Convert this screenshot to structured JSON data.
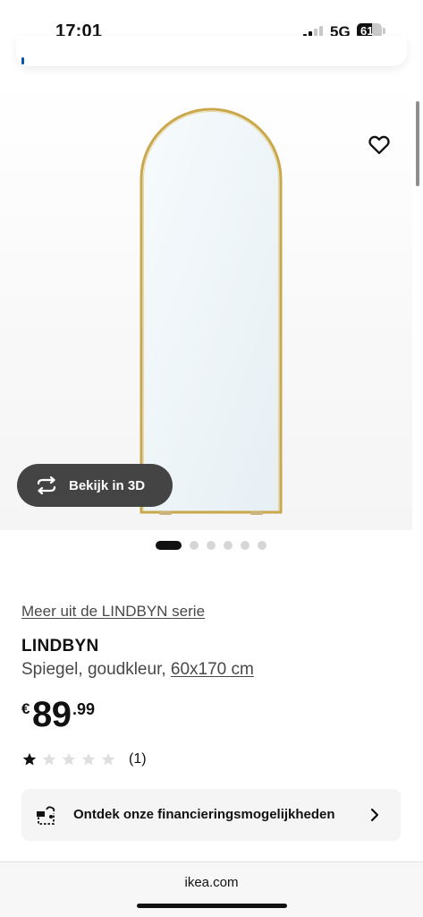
{
  "status_bar": {
    "time": "17:01",
    "network": "5G",
    "battery_level": "61",
    "battery_fraction": 0.61,
    "signal_bars_active": 2,
    "signal_bars_total": 4
  },
  "product": {
    "series_link": "Meer uit de LINDBYN serie",
    "name": "LINDBYN",
    "description": "Spiegel, goudkleur,",
    "size": "60x170 cm",
    "price": {
      "currency": "€",
      "integer": "89",
      "decimal": ".99"
    },
    "rating": {
      "stars": 1,
      "max_stars": 5,
      "count": "(1)"
    }
  },
  "gallery": {
    "view_3d_label": "Bekijk in 3D",
    "dot_count": 6,
    "active_dot": 0
  },
  "finance": {
    "label": "Ontdek onze financieringsmogelijkheden"
  },
  "browser": {
    "url": "ikea.com"
  },
  "colors": {
    "accent": "#0058a3",
    "frame_gold": "#c9a74a",
    "button_dark": "#444444"
  }
}
